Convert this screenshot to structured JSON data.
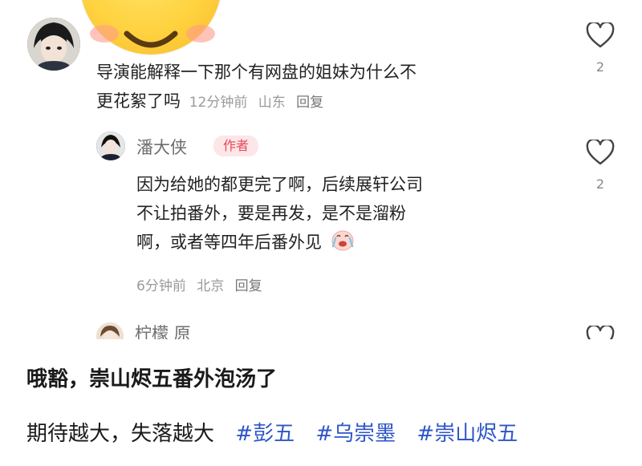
{
  "comment_top": {
    "text_line1": "导演能解释一下那个有网盘的姐妹为什么不",
    "text_line2": "更花絮了吗",
    "time": "12分钟前",
    "location": "山东",
    "reply_label": "回复",
    "like_count": "2"
  },
  "reply": {
    "author_name": "潘大侠",
    "badge": "作者",
    "text_line1": "因为给她的都更完了啊，后续展轩公司",
    "text_line2": "不让拍番外，要是再发，是不是溜粉",
    "text_line3": "啊，或者等四年后番外见",
    "time": "6分钟前",
    "location": "北京",
    "reply_label": "回复",
    "like_count": "2"
  },
  "comment_third": {
    "author_name": "柠檬 原"
  },
  "caption": {
    "headline": "哦豁，崇山烬五番外泡汤了",
    "body": "期待越大，失落越大",
    "tags": [
      "#彭五",
      "#乌崇墨",
      "#崇山烬五"
    ]
  },
  "colors": {
    "tag": "#2d55c7",
    "badge_text": "#e24a5a",
    "badge_bg": "#fde6e8",
    "meta": "#9a9a9a"
  },
  "icons": {
    "like": "heart-outline-icon",
    "reply_emoji": "crying-laugh-emoji-icon",
    "top_emoji": "smiling-face-emoji-icon"
  }
}
